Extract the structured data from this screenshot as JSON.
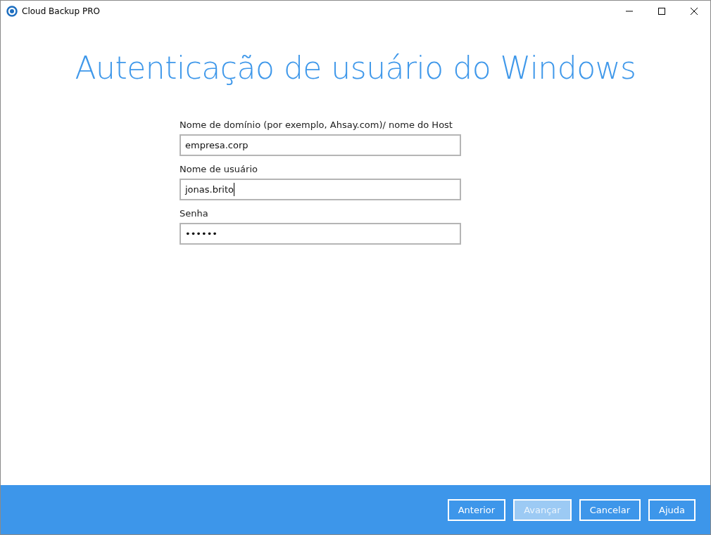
{
  "window": {
    "title": "Cloud Backup PRO"
  },
  "heading": "Autenticação de usuário do Windows",
  "fields": [
    {
      "label": "Nome de domínio (por exemplo, Ahsay.com)/ nome do Host",
      "value": "empresa.corp",
      "focused": false
    },
    {
      "label": "Nome de usuário",
      "value": "jonas.brito",
      "focused": true
    },
    {
      "label": "Senha",
      "value": "••••••",
      "focused": false
    }
  ],
  "buttons": [
    {
      "label": "Anterior",
      "disabled": false
    },
    {
      "label": "Avançar",
      "disabled": true
    },
    {
      "label": "Cancelar",
      "disabled": false
    },
    {
      "label": "Ajuda",
      "disabled": false
    }
  ]
}
